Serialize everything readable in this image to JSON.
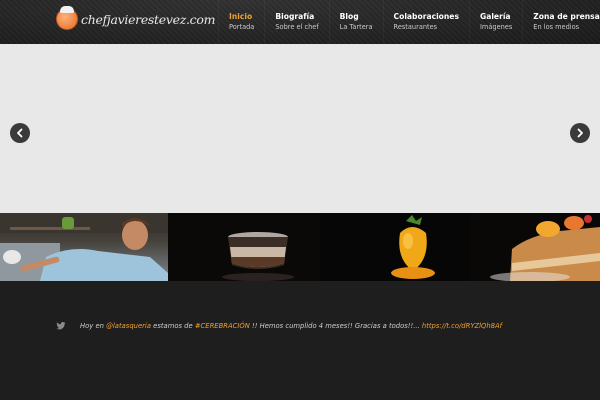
{
  "header": {
    "logo_text": "chefjavierestevez.com"
  },
  "nav": [
    {
      "label": "Inicio",
      "sub": "Portada"
    },
    {
      "label": "Biografía",
      "sub": "Sobre el chef"
    },
    {
      "label": "Blog",
      "sub": "La Tartera"
    },
    {
      "label": "Colaboraciones",
      "sub": "Restaurantes"
    },
    {
      "label": "Galería",
      "sub": "Imágenes"
    },
    {
      "label": "Zona de prensa",
      "sub": "En los medios"
    }
  ],
  "colors": {
    "accent": "#f0a030",
    "header_bg": "#252525",
    "slider_bg": "#e8e8e8",
    "footer_bg": "#1e1e1e"
  },
  "tweet": {
    "p1": "Hoy en ",
    "mention": "@latasqueria",
    "p2": " estamos de ",
    "hashtag": "#CEREBRACIÓN",
    "p3": " !! Hemos cumplido 4 meses!! Gracias a todos!!... ",
    "link": "https://t.co/dRYZlQh8Af"
  }
}
